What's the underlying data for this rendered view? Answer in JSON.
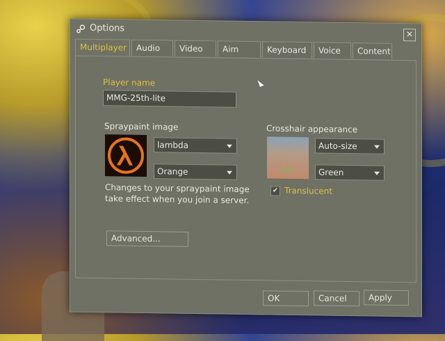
{
  "window": {
    "title": "Options",
    "close_glyph": "✕"
  },
  "tabs": [
    {
      "label": "Multiplayer",
      "active": true
    },
    {
      "label": "Audio"
    },
    {
      "label": "Video"
    },
    {
      "label": "Aim"
    },
    {
      "label": "Keyboard"
    },
    {
      "label": "Voice"
    },
    {
      "label": "Content"
    }
  ],
  "player": {
    "label": "Player name",
    "value": "MMG-25th-lite"
  },
  "spray": {
    "label": "Spraypaint image",
    "image_value": "lambda",
    "color_value": "Orange",
    "note_line1": "Changes to your spraypaint image",
    "note_line2": "take effect when you join a server."
  },
  "crosshair": {
    "label": "Crosshair appearance",
    "size_value": "Auto-size",
    "color_value": "Green",
    "translucent_label": "Translucent",
    "translucent_checked": true
  },
  "advanced_label": "Advanced...",
  "footer": {
    "ok": "OK",
    "cancel": "Cancel",
    "apply": "Apply"
  },
  "colors": {
    "accent": "#e0c040",
    "panel": "#6e7163",
    "field": "#4c4e44",
    "spray_logo": "#e8731c",
    "crosshair": "#30e030"
  },
  "icons": {
    "title": "steam-logo-icon",
    "close": "close-icon",
    "spray": "lambda-logo-icon",
    "dropdown": "chevron-down-icon"
  }
}
